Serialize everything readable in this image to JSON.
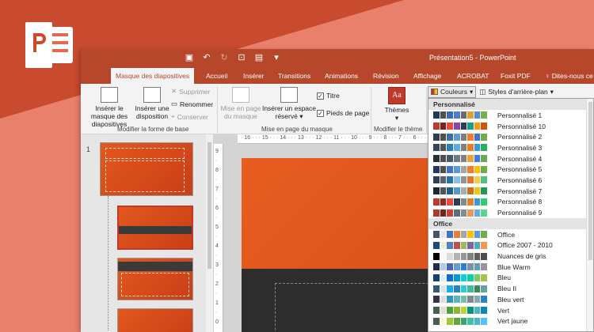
{
  "window": {
    "title": "Présentation5 - PowerPoint"
  },
  "tabs": [
    {
      "label": "Masque des diapositives"
    },
    {
      "label": "Accueil"
    },
    {
      "label": "Insérer"
    },
    {
      "label": "Transitions"
    },
    {
      "label": "Animations"
    },
    {
      "label": "Révision"
    },
    {
      "label": "Affichage"
    },
    {
      "label": "ACROBAT"
    },
    {
      "label": "Foxit PDF"
    },
    {
      "label": "Dites-nous ce"
    }
  ],
  "ribbon": {
    "insert_master": "Insérer le masque des diapositives",
    "insert_layout": "Insérer une disposition",
    "delete": "Supprimer",
    "rename": "Renommer",
    "preserve": "Conserver",
    "group_edit_master": "Modifier la forme de base",
    "layout_master": "Mise en page du masque",
    "insert_placeholder": "Insérer un espace réservé",
    "title_check": "Titre",
    "footer_check": "Pieds de page",
    "group_layout": "Mise en page du masque",
    "themes": "Thèmes",
    "group_theme": "Modifier le thème",
    "colors": "Couleurs",
    "bg_styles": "Styles d'arrière-plan"
  },
  "slide_pane": {
    "number": "1"
  },
  "ruler": {
    "h": "· 16 · · · 15 · · · 14 · · · 13 · · · 12 · · · 11 · · · 10 · · · 9 · · · 8 · · · 7 · · · 6 · · · 5 · · · 4 · · · 3",
    "v": "9 · 8 · 7 · 6 · 5 · 4 · 3 · 2 · 1 · 0"
  },
  "colors_menu": {
    "custom_heading": "Personnalisé",
    "custom": [
      {
        "name": "Personnalisé 1",
        "c": [
          "#1f3a5f",
          "#4f4f4f",
          "#3b6bb5",
          "#4d7dd0",
          "#6b6b6b",
          "#e0a030",
          "#4f8fd0",
          "#7ab04a"
        ]
      },
      {
        "name": "Personnalisé 10",
        "c": [
          "#c0392b",
          "#7b241c",
          "#e74c3c",
          "#8e44ad",
          "#2c3e50",
          "#16a085",
          "#f39c12",
          "#d35400"
        ]
      },
      {
        "name": "Personnalisé 2",
        "c": [
          "#2c3e50",
          "#4f4f4f",
          "#3a6ea5",
          "#5b9bd5",
          "#7f7f7f",
          "#ed7d31",
          "#4472c4",
          "#70ad47"
        ]
      },
      {
        "name": "Personnalisé 3",
        "c": [
          "#34495e",
          "#555",
          "#2980b9",
          "#5dade2",
          "#808080",
          "#e67e22",
          "#3498db",
          "#27ae60"
        ]
      },
      {
        "name": "Personnalisé 4",
        "c": [
          "#263238",
          "#4f4f4f",
          "#455a64",
          "#6c7a89",
          "#808080",
          "#f0a030",
          "#3b7dd8",
          "#6aa84f"
        ]
      },
      {
        "name": "Personnalisé 5",
        "c": [
          "#1f3a5f",
          "#4f4f4f",
          "#4472c4",
          "#5b9bd5",
          "#a5a5a5",
          "#ed7d31",
          "#ffc000",
          "#70ad47"
        ]
      },
      {
        "name": "Personnalisé 6",
        "c": [
          "#2e4053",
          "#566573",
          "#2874a6",
          "#85c1e9",
          "#909497",
          "#dc7633",
          "#f4d03f",
          "#52be80"
        ]
      },
      {
        "name": "Personnalisé 7",
        "c": [
          "#1b2631",
          "#4d5656",
          "#1f618d",
          "#5499c7",
          "#a6acaf",
          "#ca6f1e",
          "#f1c40f",
          "#229954"
        ]
      },
      {
        "name": "Personnalisé 8",
        "c": [
          "#c0392b",
          "#922b21",
          "#e74c3c",
          "#2c3e50",
          "#7f8c8d",
          "#e67e22",
          "#3498db",
          "#2ecc71"
        ]
      },
      {
        "name": "Personnalisé 9",
        "c": [
          "#b03a2e",
          "#7b241c",
          "#cb4335",
          "#5d6d7e",
          "#808b96",
          "#eb984e",
          "#5dade2",
          "#58d68d"
        ]
      }
    ],
    "office_heading": "Office",
    "office": [
      {
        "name": "Office",
        "c": [
          "#44546a",
          "#e7e6e6",
          "#4472c4",
          "#ed7d31",
          "#a5a5a5",
          "#ffc000",
          "#5b9bd5",
          "#70ad47"
        ]
      },
      {
        "name": "Office 2007 - 2010",
        "c": [
          "#1f497d",
          "#eeece1",
          "#4f81bd",
          "#c0504d",
          "#9bbb59",
          "#8064a2",
          "#4bacc6",
          "#f79646"
        ]
      },
      {
        "name": "Nuances de gris",
        "c": [
          "#000000",
          "#f8f8f8",
          "#dddddd",
          "#b2b2b2",
          "#969696",
          "#808080",
          "#5f5f5f",
          "#4d4d4d"
        ]
      },
      {
        "name": "Blue Warm",
        "c": [
          "#242852",
          "#acccea",
          "#4a66ac",
          "#629dd1",
          "#297fd5",
          "#7f8fa9",
          "#5aa2ae",
          "#9d90a0"
        ]
      },
      {
        "name": "Bleu",
        "c": [
          "#17406d",
          "#dbeff9",
          "#0f6fc6",
          "#009dd9",
          "#0bd0d9",
          "#10cf9b",
          "#7cca62",
          "#a5c249"
        ]
      },
      {
        "name": "Bleu II",
        "c": [
          "#335b74",
          "#dfe3e5",
          "#1cade4",
          "#2683c6",
          "#27ced7",
          "#42ba97",
          "#3e8853",
          "#62a39f"
        ]
      },
      {
        "name": "Bleu vert",
        "c": [
          "#373545",
          "#dedede",
          "#3494ba",
          "#58b6c0",
          "#75bda7",
          "#7a8c8e",
          "#84acb6",
          "#2683c6"
        ]
      },
      {
        "name": "Vert",
        "c": [
          "#455f51",
          "#e3ded1",
          "#549e39",
          "#8ab833",
          "#c0cf3a",
          "#029676",
          "#4ab5c4",
          "#0989b1"
        ]
      },
      {
        "name": "Vert jaune",
        "c": [
          "#455f51",
          "#fffcd5",
          "#99cb38",
          "#63a537",
          "#37a76f",
          "#44c1a3",
          "#4eb3cf",
          "#51c3f9"
        ]
      }
    ]
  }
}
